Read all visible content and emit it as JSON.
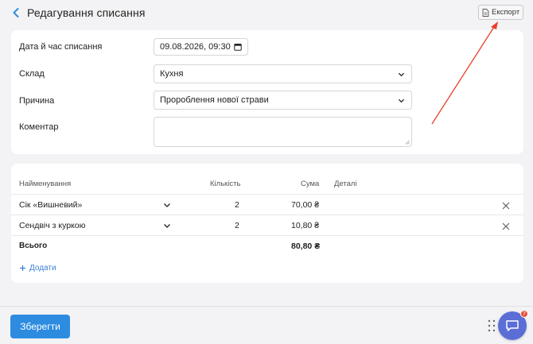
{
  "header": {
    "title": "Редагування списання",
    "export_label": "Експорт"
  },
  "form": {
    "date_label": "Дата й час списання",
    "date_value": "09.08.2026, 09:30",
    "warehouse_label": "Склад",
    "warehouse_value": "Кухня",
    "reason_label": "Причина",
    "reason_value": "Пророблення нової страви",
    "comment_label": "Коментар",
    "comment_value": ""
  },
  "table": {
    "headers": {
      "name": "Найменування",
      "qty": "Кількість",
      "sum": "Сума",
      "details": "Деталі"
    },
    "rows": [
      {
        "name": "Сік «Вишневий»",
        "qty": "2",
        "sum": "70,00 ₴",
        "details": ""
      },
      {
        "name": "Сендвіч з куркою",
        "qty": "2",
        "sum": "10,80 ₴",
        "details": ""
      }
    ],
    "total_label": "Всього",
    "total_sum": "80,80 ₴",
    "add_label": "Додати"
  },
  "footer": {
    "save_label": "Зберегти",
    "chat_badge": "7"
  },
  "colors": {
    "accent": "#2d8ce0",
    "chat": "#5a6ed6",
    "annotation_arrow": "#e8402c"
  },
  "icons": [
    "back-chevron-icon",
    "document-icon",
    "calendar-icon",
    "chevron-down-icon",
    "close-icon",
    "plus-icon",
    "grip-icon",
    "chat-icon"
  ]
}
